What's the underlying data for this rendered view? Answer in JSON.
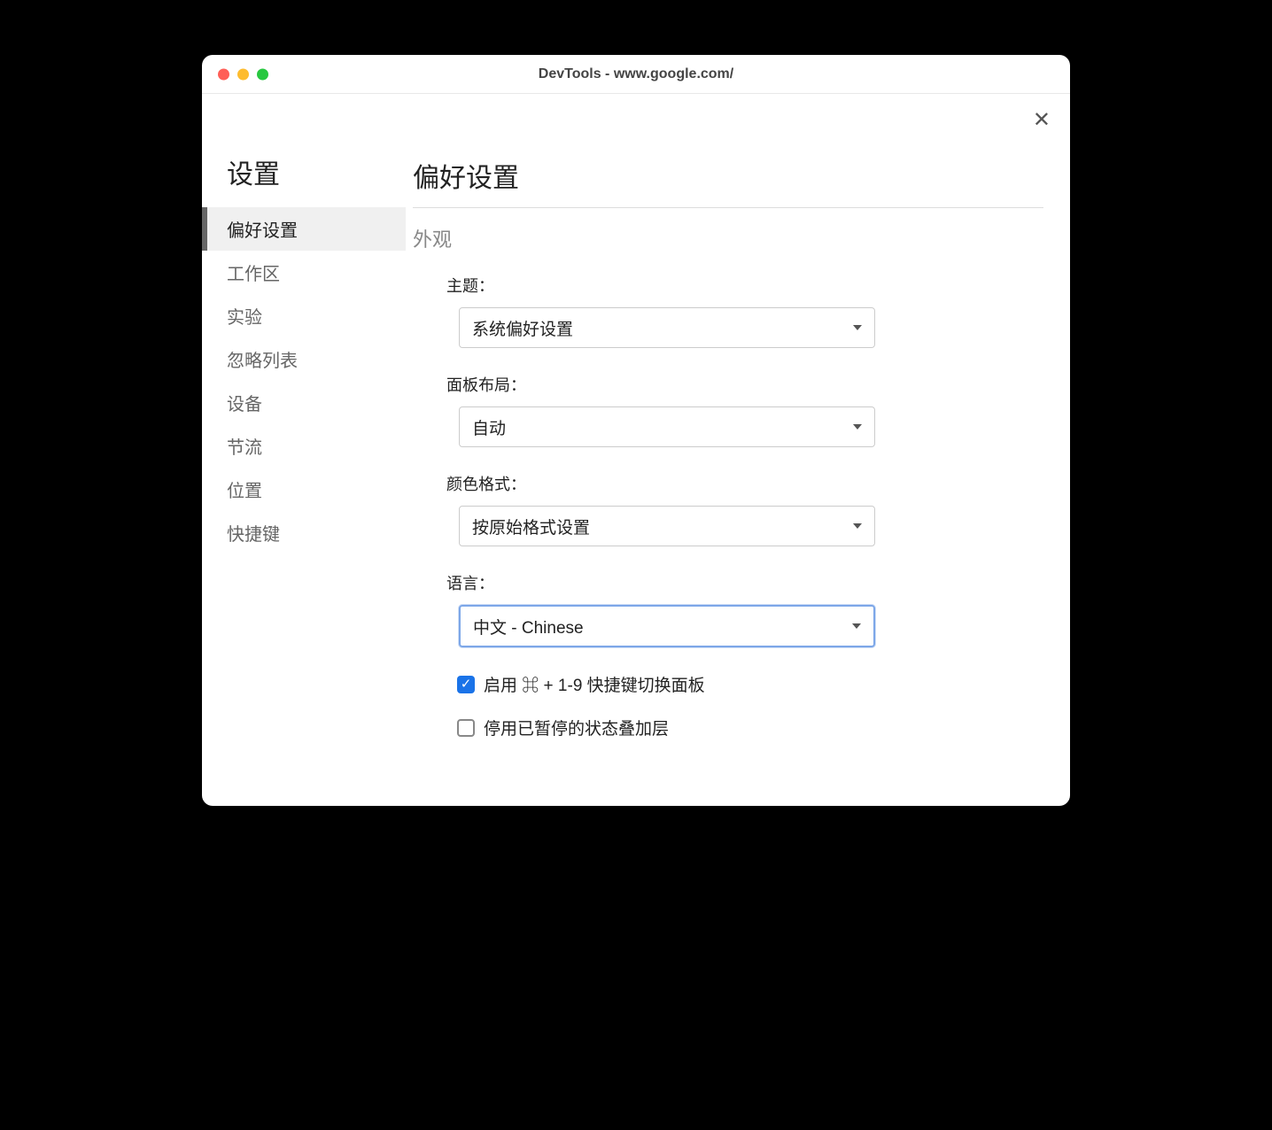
{
  "window": {
    "title": "DevTools - www.google.com/"
  },
  "sidebar": {
    "title": "设置",
    "items": [
      {
        "label": "偏好设置",
        "active": true
      },
      {
        "label": "工作区",
        "active": false
      },
      {
        "label": "实验",
        "active": false
      },
      {
        "label": "忽略列表",
        "active": false
      },
      {
        "label": "设备",
        "active": false
      },
      {
        "label": "节流",
        "active": false
      },
      {
        "label": "位置",
        "active": false
      },
      {
        "label": "快捷键",
        "active": false
      }
    ]
  },
  "main": {
    "title": "偏好设置",
    "section": "外观",
    "fields": {
      "theme": {
        "label": "主题：",
        "value": "系统偏好设置"
      },
      "panel_layout": {
        "label": "面板布局：",
        "value": "自动"
      },
      "color_format": {
        "label": "颜色格式：",
        "value": "按原始格式设置"
      },
      "language": {
        "label": "语言：",
        "value": "中文 - Chinese"
      }
    },
    "checkboxes": {
      "shortcut": {
        "label": "启用 ⌘ + 1-9 快捷键切换面板",
        "checked": true
      },
      "overlay": {
        "label": "停用已暂停的状态叠加层",
        "checked": false
      }
    }
  }
}
